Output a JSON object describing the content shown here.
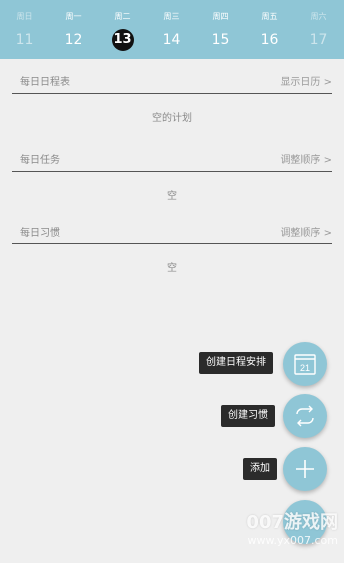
{
  "week": {
    "days": [
      {
        "name": "周日",
        "num": "11"
      },
      {
        "name": "周一",
        "num": "12"
      },
      {
        "name": "周二",
        "num": "13"
      },
      {
        "name": "周三",
        "num": "14"
      },
      {
        "name": "周四",
        "num": "15"
      },
      {
        "name": "周五",
        "num": "16"
      },
      {
        "name": "周六",
        "num": "17"
      }
    ]
  },
  "sections": {
    "schedule": {
      "label": "每日日程表",
      "action": "显示日历 >",
      "empty": "空的计划"
    },
    "tasks": {
      "label": "每日任务",
      "action": "调整顺序 >",
      "empty": "空"
    },
    "habits": {
      "label": "每日习惯",
      "action": "调整顺序 >",
      "empty": "空"
    }
  },
  "fab_menu": {
    "create_schedule": {
      "label": "创建日程安排",
      "icon": "calendar-icon",
      "icon_text": "21"
    },
    "create_habit": {
      "label": "创建习惯",
      "icon": "repeat-icon"
    },
    "add": {
      "label": "添加",
      "icon": "plus-icon"
    }
  },
  "watermark": {
    "main": "007游戏网",
    "url": "www.yx007.com"
  },
  "colors": {
    "accent": "#8fc6d6",
    "selected": "#111111",
    "background": "#efefef"
  }
}
